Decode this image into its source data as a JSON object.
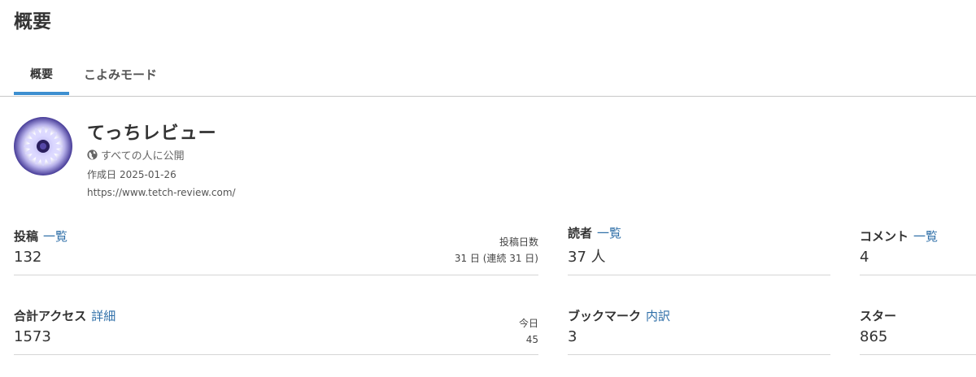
{
  "page": {
    "title": "概要"
  },
  "tabs": [
    {
      "label": "概要",
      "active": true
    },
    {
      "label": "こよみモード",
      "active": false
    }
  ],
  "blog": {
    "title": "てっちレビュー",
    "visibility": "すべての人に公開",
    "visibility_icon": "globe-icon",
    "created_label": "作成日",
    "created_date": "2025-01-26",
    "url": "https://www.tetch-review.com/"
  },
  "stats": {
    "posts": {
      "label": "投稿",
      "link": "一覧",
      "value": "132",
      "sub_label": "投稿日数",
      "sub_value": "31 日 (連続 31 日)"
    },
    "readers": {
      "label": "読者",
      "link": "一覧",
      "value": "37 人"
    },
    "comments": {
      "label": "コメント",
      "link": "一覧",
      "value": "4"
    },
    "access": {
      "label": "合計アクセス",
      "link": "詳細",
      "value": "1573",
      "sub_label": "今日",
      "sub_value": "45"
    },
    "bookmarks": {
      "label": "ブックマーク",
      "link": "内訳",
      "value": "3"
    },
    "stars": {
      "label": "スター",
      "value": "865"
    }
  },
  "colors": {
    "link": "#2f6fa8",
    "tab_active": "#3d8fd0"
  }
}
